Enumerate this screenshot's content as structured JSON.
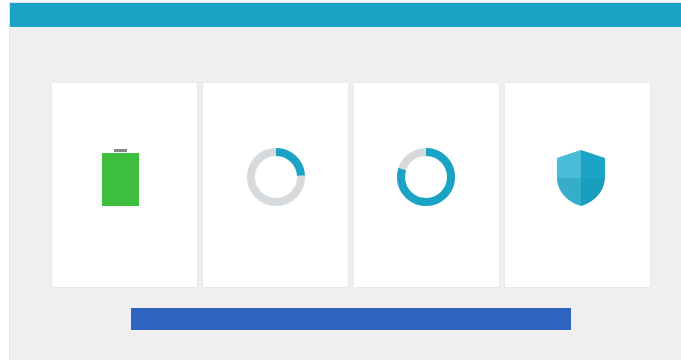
{
  "window": {
    "title": "",
    "colors": {
      "titlebar": "#1aa3c4",
      "background": "#efefef",
      "green": "#3dbf3d",
      "teal": "#1aa3c4",
      "button": "#2e63bf"
    }
  },
  "cards": {
    "battery": {
      "title": "",
      "percent_label": "",
      "status": "",
      "level": 1.0
    },
    "storage": {
      "title": "",
      "percent_label": "",
      "status": "",
      "subtext": "",
      "fill": 0.24
    },
    "ram": {
      "title": "",
      "percent_label": "",
      "status": "",
      "subtext": "",
      "fill": 0.8
    },
    "security": {
      "title": "",
      "status": "",
      "subtext": "",
      "icon": "shield-icon"
    }
  },
  "action_button": {
    "label": ""
  }
}
